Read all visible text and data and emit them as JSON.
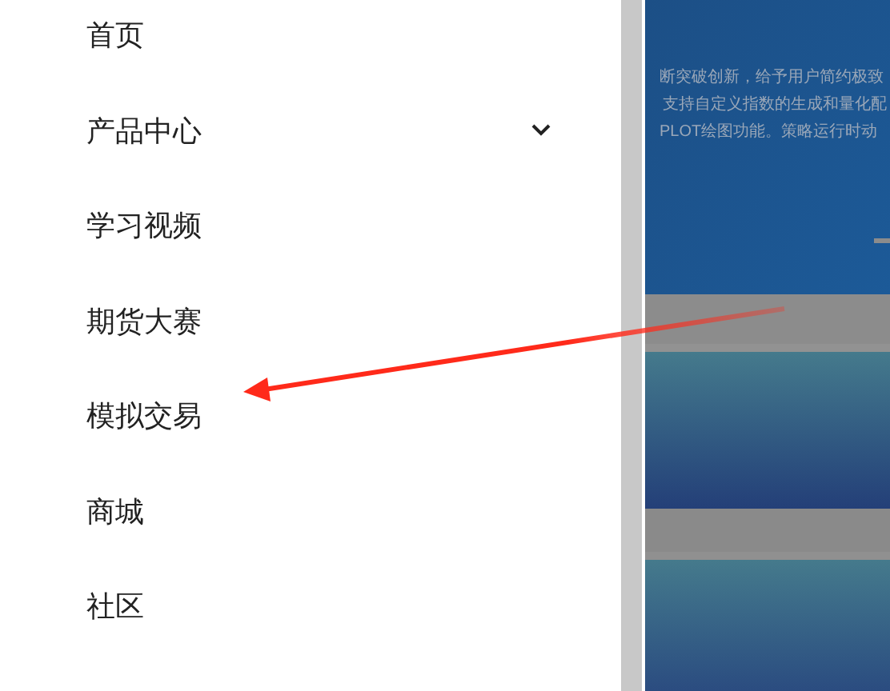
{
  "menu": {
    "items": [
      {
        "label": "首页",
        "has_submenu": false
      },
      {
        "label": "产品中心",
        "has_submenu": true
      },
      {
        "label": "学习视频",
        "has_submenu": false
      },
      {
        "label": "期货大赛",
        "has_submenu": false
      },
      {
        "label": "模拟交易",
        "has_submenu": false
      },
      {
        "label": "商城",
        "has_submenu": false
      },
      {
        "label": "社区",
        "has_submenu": false
      }
    ]
  },
  "background_page": {
    "banner_lines": [
      "断突破创新，给予用户简约极致",
      "支持自定义指数的生成和量化配",
      "PLOT绘图功能。策略运行时动"
    ]
  },
  "annotation": {
    "kind": "arrow",
    "color": "#ff2a1a"
  }
}
